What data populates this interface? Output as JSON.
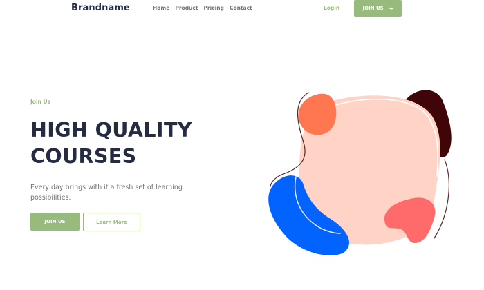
{
  "header": {
    "brand": "Brandname",
    "nav": [
      {
        "label": "Home"
      },
      {
        "label": "Product"
      },
      {
        "label": "Pricing"
      },
      {
        "label": "Contact"
      }
    ],
    "login_label": "Login",
    "join_label": "JOIN US",
    "join_icon": "arrow-right-icon"
  },
  "hero": {
    "eyebrow": "Join Us",
    "title_line1": "HIGH QUALITY",
    "title_line2": "COURSES",
    "subtitle": "Every day brings with it a fresh set of learning possibilities.",
    "join_label": "JOIN US",
    "learn_label": "Learn More"
  },
  "colors": {
    "accent": "#96bb7c",
    "heading": "#252b42",
    "muted": "#737373",
    "blob_peach": "#ffd4c6",
    "blob_orange": "#ff7751",
    "blob_maroon": "#3f0508",
    "blob_blue": "#0363ff",
    "blob_coral": "#ff6b6b"
  }
}
